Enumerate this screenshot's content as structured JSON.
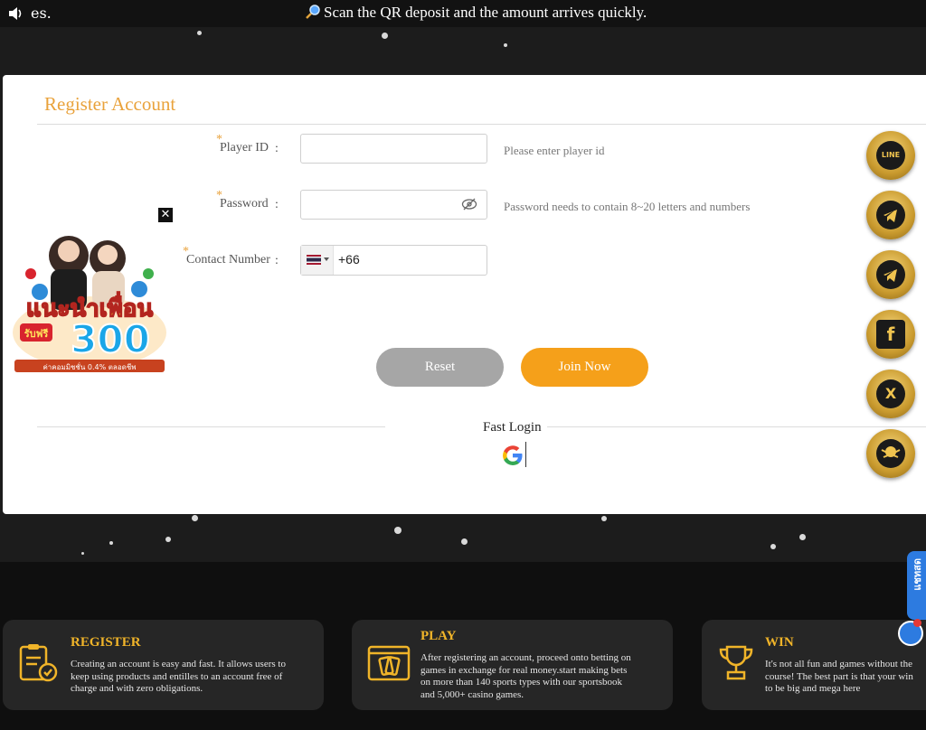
{
  "marquee": {
    "lead_text": "es.",
    "message": "Scan the QR deposit and the amount arrives quickly."
  },
  "modal": {
    "title": "Register Account",
    "fields": {
      "player_id": {
        "label": "Player ID",
        "colon": ":",
        "value": "",
        "hint": "Please enter player id"
      },
      "password": {
        "label": "Password",
        "colon": ":",
        "value": "",
        "hint": "Password needs to contain 8~20 letters and numbers"
      },
      "contact": {
        "label": "Contact Number",
        "colon": ":",
        "country_code": "+66"
      }
    },
    "required_marker": "*",
    "buttons": {
      "reset": "Reset",
      "join": "Join Now"
    },
    "fast_login": "Fast Login"
  },
  "social_icons": [
    {
      "name": "line-icon",
      "label": "LINE"
    },
    {
      "name": "telegram-icon",
      "label": ""
    },
    {
      "name": "telegram-icon",
      "label": ""
    },
    {
      "name": "facebook-icon",
      "label": "f"
    },
    {
      "name": "x-icon",
      "label": "X"
    },
    {
      "name": "brand-logo-icon",
      "label": ""
    }
  ],
  "promo": {
    "headline": "แนะนำเพื่อน",
    "badge": "รับฟรี",
    "amount": "300",
    "footer": "ค่าคอมมิชชั่น 0.4% ตลอดชีพ"
  },
  "cards": [
    {
      "title": "REGISTER",
      "text": [
        "Creating an account is easy and fast. It allows users to",
        "keep using products and entilles to an account free of",
        "charge and with zero obligations."
      ]
    },
    {
      "title": "PLAY",
      "text": [
        "After registering an account, proceed onto betting on",
        "games in exchange for real money.start making bets",
        "on more than 140 sports types with our sportsbook",
        "and 5,000+ casino games."
      ]
    },
    {
      "title": "WIN",
      "text": [
        "It's not all fun and games without the",
        "course! The best part is that your win",
        "to be big and mega here"
      ]
    }
  ],
  "chat": {
    "tab_label": "แชทสด"
  },
  "colors": {
    "accent": "#f5a01a",
    "title": "#e9a23b",
    "gold": "#f0b429",
    "reset": "#a6a6a6"
  }
}
